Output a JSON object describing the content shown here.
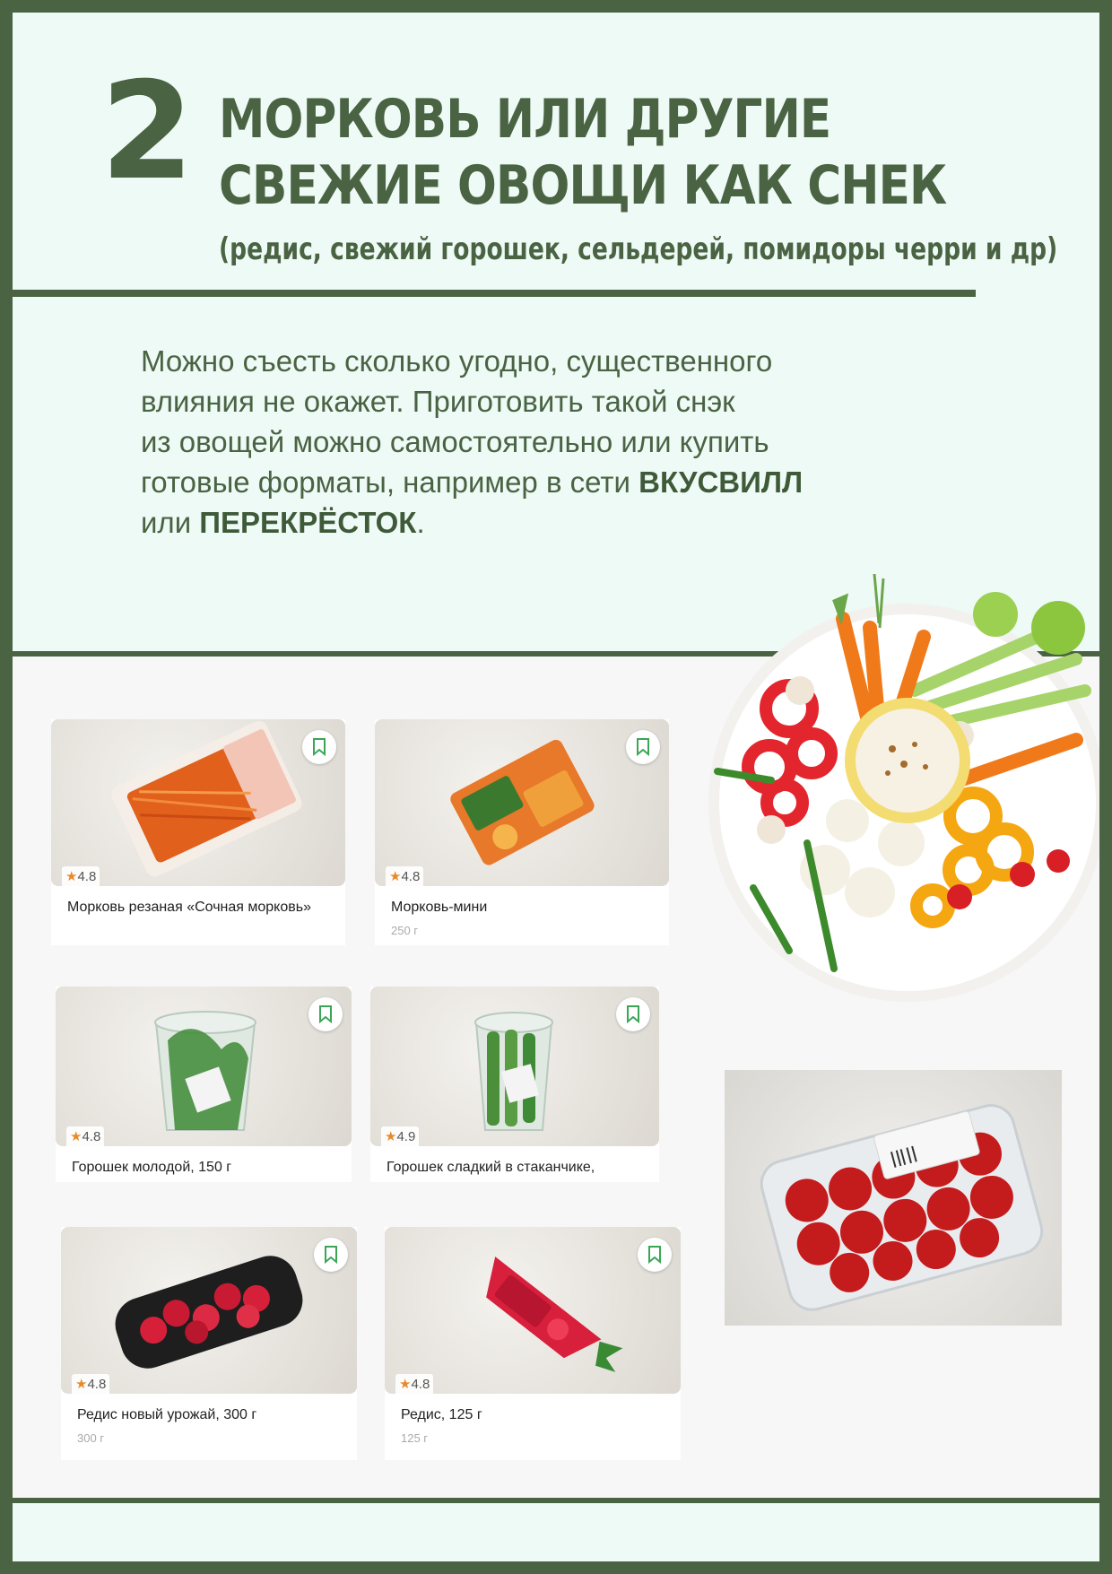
{
  "section": {
    "number": "2",
    "title_line1": "МОРКОВЬ ИЛИ ДРУГИЕ",
    "title_line2": "СВЕЖИЕ ОВОЩИ КАК СНЕК",
    "subtitle": "(редис, свежий горошек, сельдерей, помидоры черри и др)"
  },
  "body": {
    "line1": "Можно съесть сколько угодно, существенного",
    "line2": "влияния не окажет. Приготовить такой снэк",
    "line3": "из овощей можно самостоятельно или купить",
    "line4_prefix": "готовые форматы, например в сети ",
    "brand1": "ВКУСВИЛЛ",
    "line5_prefix": "или ",
    "brand2": "ПЕРЕКРЁСТОК",
    "line5_suffix": "."
  },
  "products": [
    {
      "rating": "4.8",
      "name": "Морковь резаная «Сочная морковь»",
      "price": ""
    },
    {
      "rating": "4.8",
      "name": "Морковь-мини",
      "price": "250 г"
    },
    {
      "rating": "4.8",
      "name": "Горошек молодой, 150 г",
      "price": ""
    },
    {
      "rating": "4.9",
      "name": "Горошек сладкий в стаканчике,",
      "price": ""
    },
    {
      "rating": "4.8",
      "name": "Редис новый урожай, 300 г",
      "price": "300 г"
    },
    {
      "rating": "4.8",
      "name": "Редис, 125 г",
      "price": "125 г"
    }
  ],
  "colors": {
    "accent": "#4a6343",
    "background": "#eefaf6",
    "star": "#e88a2a"
  },
  "icons": {
    "bookmark": "bookmark-icon",
    "star": "star-icon"
  }
}
